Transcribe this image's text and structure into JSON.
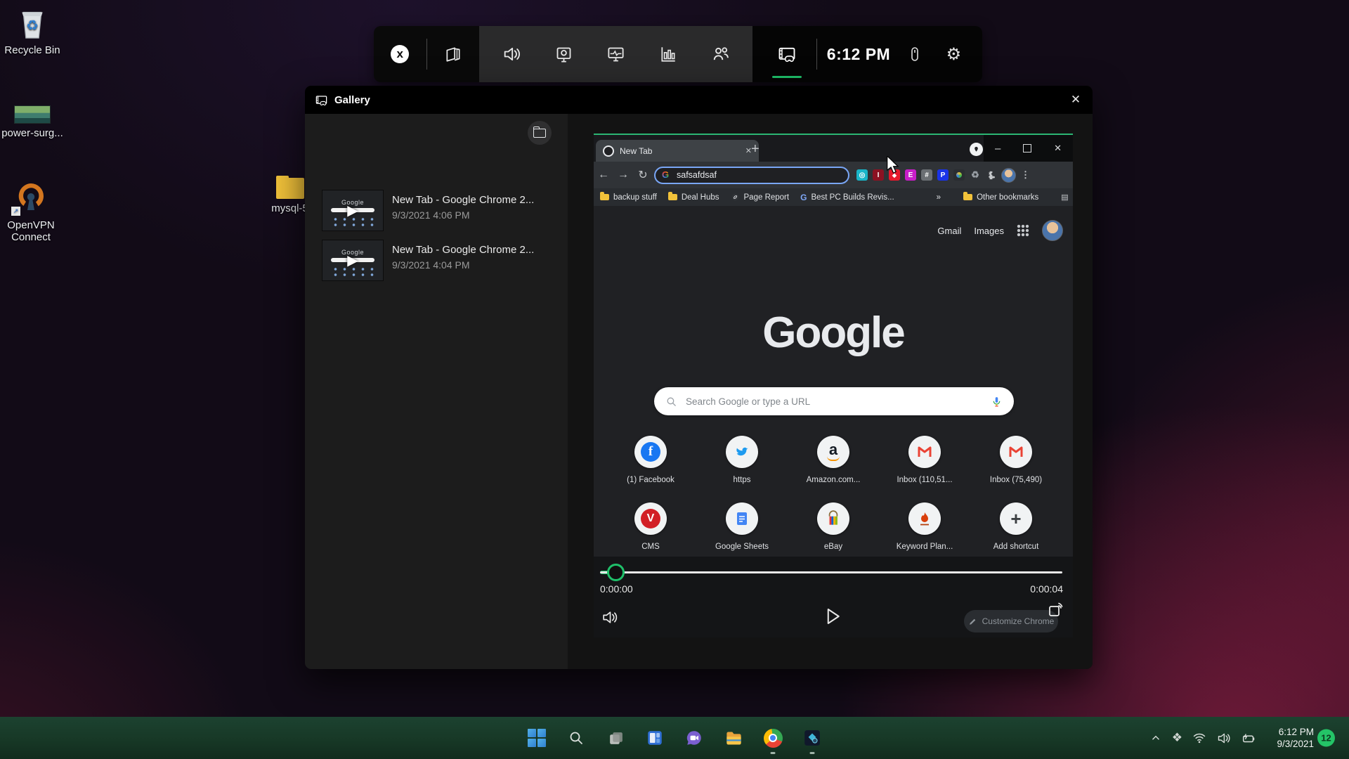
{
  "colors": {
    "accent_green": "#1fc06a",
    "record_border_green": "#2bb673",
    "taskbar_green": "#1c4230",
    "focus_ring_blue": "#79a6f6"
  },
  "desktop": {
    "icons": [
      {
        "label": "Recycle Bin"
      },
      {
        "label": "power-surg..."
      },
      {
        "label": "OpenVPN Connect"
      },
      {
        "label": "mysql-5"
      }
    ]
  },
  "gamebar": {
    "time": "6:12 PM",
    "icon_names": [
      "xbox-home",
      "widgets",
      "audio",
      "capture",
      "performance",
      "resources",
      "social",
      "gallery",
      "mouse",
      "settings"
    ]
  },
  "gallery": {
    "title": "Gallery",
    "items": [
      {
        "title": "New Tab - Google Chrome 2...",
        "date": "9/3/2021 4:06 PM"
      },
      {
        "title": "New Tab - Google Chrome 2...",
        "date": "9/3/2021 4:04 PM"
      }
    ]
  },
  "chrome": {
    "tab_title": "New Tab",
    "url_text": "safsafdsaf",
    "bookmarks": [
      "backup stuff",
      "Deal Hubs",
      "Page Report",
      "Best PC Builds Revis...",
      "»",
      "Other bookmarks",
      "Reading list"
    ],
    "nav": {
      "gmail": "Gmail",
      "images": "Images"
    },
    "logo": "Google",
    "search_placeholder": "Search Google or type a URL",
    "shortcuts_row1": [
      "(1) Facebook",
      "https",
      "Amazon.com...",
      "Inbox (110,51...",
      "Inbox (75,490)"
    ],
    "shortcuts_row2": [
      "CMS",
      "Google Sheets",
      "eBay",
      "Keyword Plan...",
      "Add shortcut"
    ],
    "customize_label": "Customize Chrome"
  },
  "player": {
    "current_time": "0:00:00",
    "duration": "0:00:04"
  },
  "taskbar": {
    "time": "6:12 PM",
    "date": "9/3/2021",
    "badge_count": "12"
  }
}
